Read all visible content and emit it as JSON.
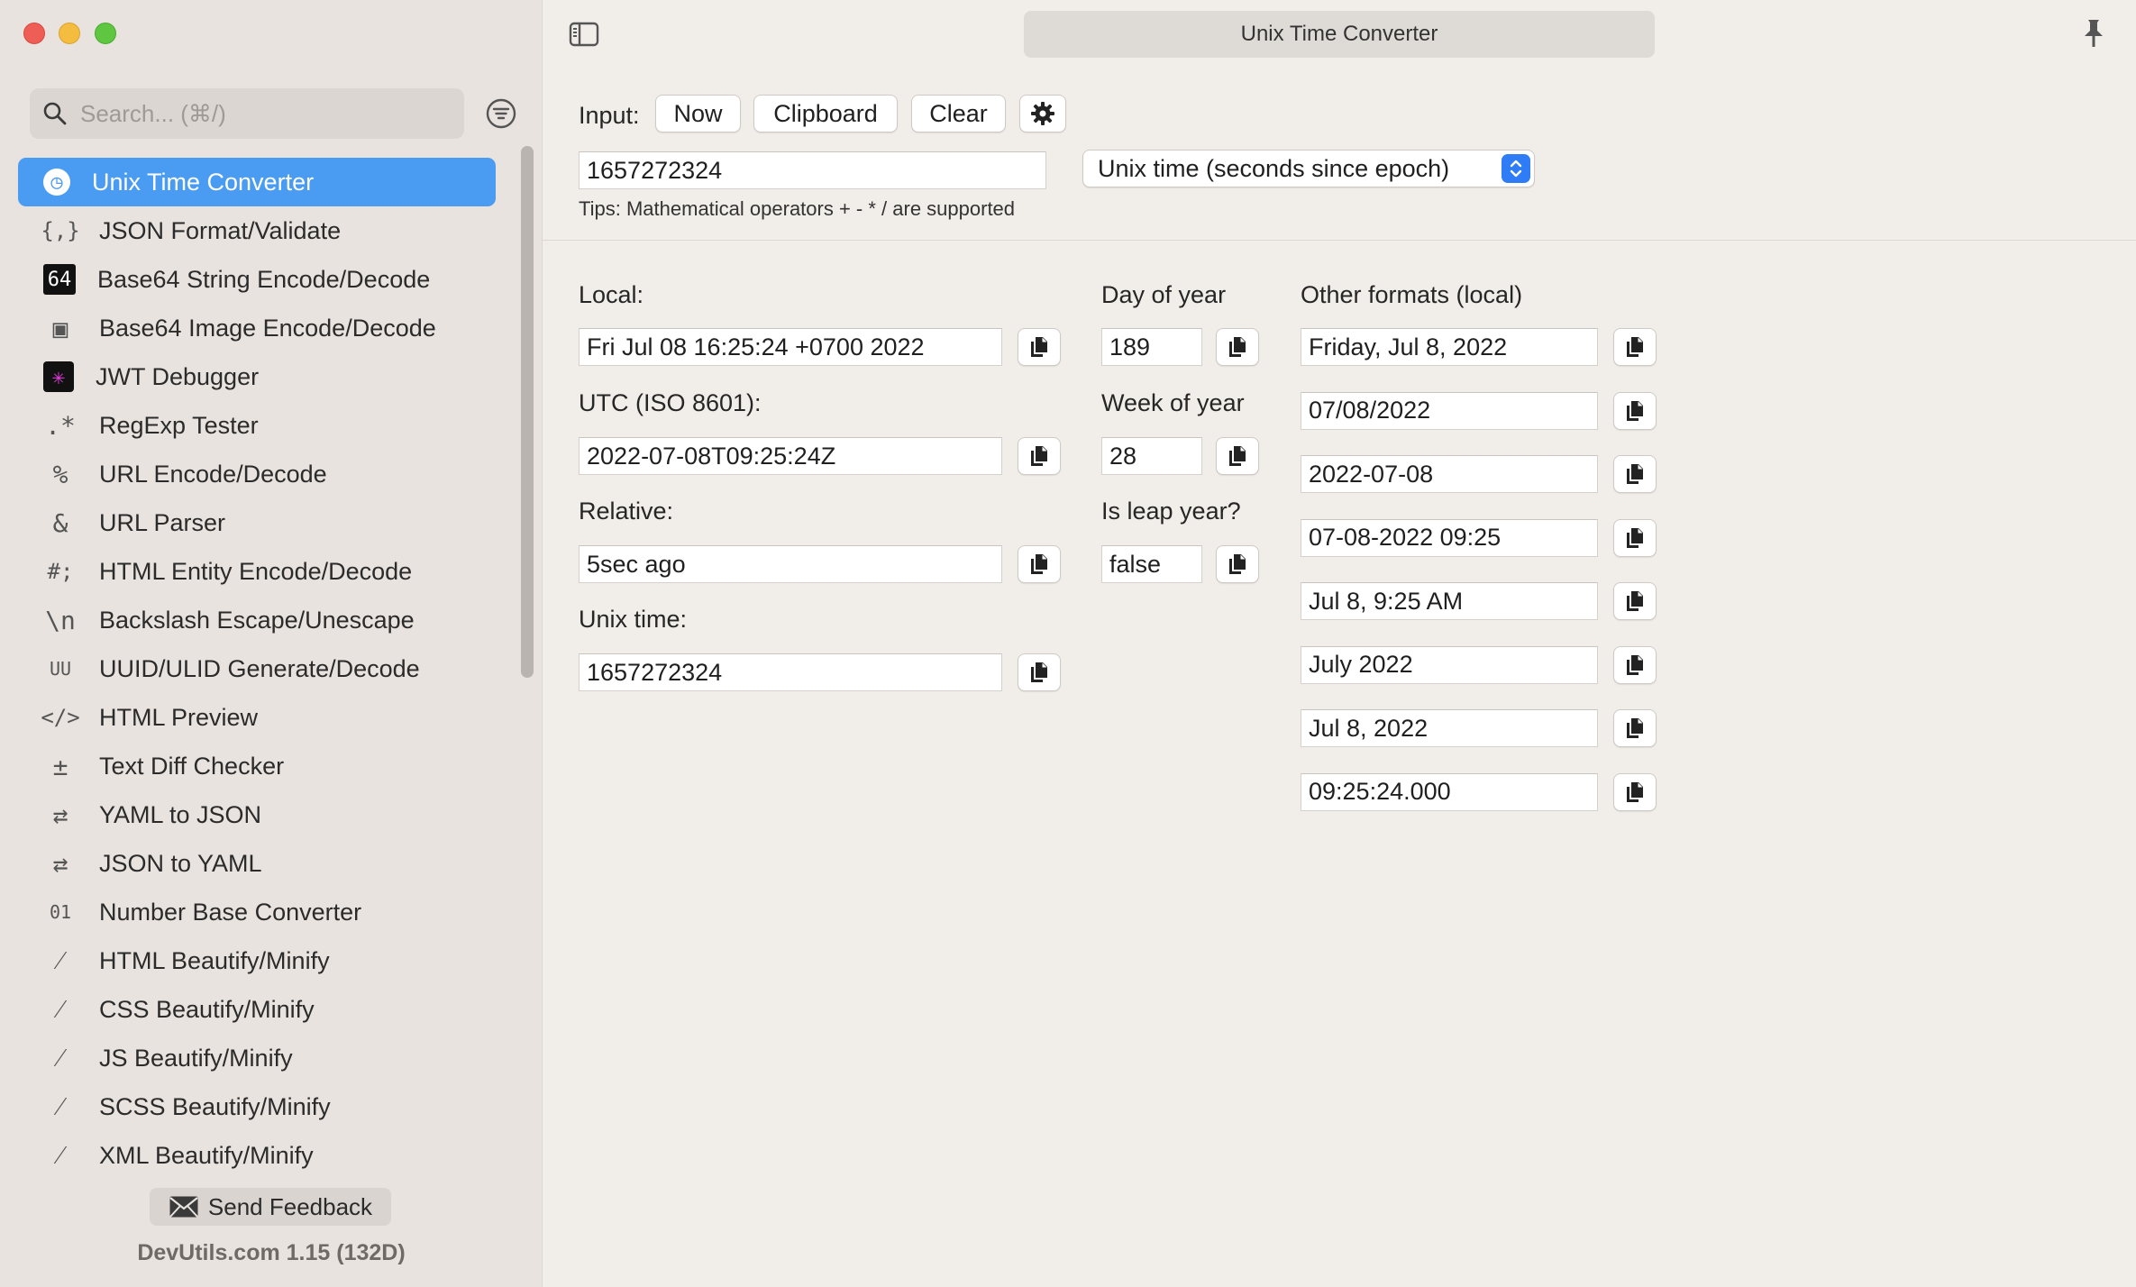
{
  "window": {
    "title": "Unix Time Converter"
  },
  "sidebar": {
    "search_placeholder": "Search... (⌘/)",
    "items": [
      {
        "label": "Unix Time Converter",
        "icon": "clock-icon",
        "glyph": "◷"
      },
      {
        "label": "JSON Format/Validate",
        "icon": "braces-icon",
        "glyph": "{,}"
      },
      {
        "label": "Base64 String Encode/Decode",
        "icon": "base64-icon",
        "glyph": "64"
      },
      {
        "label": "Base64 Image Encode/Decode",
        "icon": "image-icon",
        "glyph": "▣"
      },
      {
        "label": "JWT Debugger",
        "icon": "jwt-icon",
        "glyph": "✳"
      },
      {
        "label": "RegExp Tester",
        "icon": "regex-icon",
        "glyph": ".*"
      },
      {
        "label": "URL Encode/Decode",
        "icon": "percent-icon",
        "glyph": "%"
      },
      {
        "label": "URL Parser",
        "icon": "ampersand-icon",
        "glyph": "&"
      },
      {
        "label": "HTML Entity Encode/Decode",
        "icon": "hash-icon",
        "glyph": "#;"
      },
      {
        "label": "Backslash Escape/Unescape",
        "icon": "backslash-icon",
        "glyph": "\\n"
      },
      {
        "label": "UUID/ULID Generate/Decode",
        "icon": "uuid-icon",
        "glyph": "UU"
      },
      {
        "label": "HTML Preview",
        "icon": "code-icon",
        "glyph": "</>"
      },
      {
        "label": "Text Diff Checker",
        "icon": "diff-icon",
        "glyph": "±"
      },
      {
        "label": "YAML to JSON",
        "icon": "swap-icon",
        "glyph": "⇄"
      },
      {
        "label": "JSON to YAML",
        "icon": "swap-icon",
        "glyph": "⇄"
      },
      {
        "label": "Number Base Converter",
        "icon": "number-base-icon",
        "glyph": "01"
      },
      {
        "label": "HTML Beautify/Minify",
        "icon": "wand-icon",
        "glyph": "⁄"
      },
      {
        "label": "CSS Beautify/Minify",
        "icon": "wand-icon",
        "glyph": "⁄"
      },
      {
        "label": "JS Beautify/Minify",
        "icon": "wand-icon",
        "glyph": "⁄"
      },
      {
        "label": "SCSS Beautify/Minify",
        "icon": "wand-icon",
        "glyph": "⁄"
      },
      {
        "label": "XML Beautify/Minify",
        "icon": "wand-icon",
        "glyph": "⁄"
      }
    ],
    "feedback_label": "Send Feedback",
    "version": "DevUtils.com 1.15 (132D)"
  },
  "input": {
    "label": "Input:",
    "now_label": "Now",
    "clipboard_label": "Clipboard",
    "clear_label": "Clear",
    "value": "1657272324",
    "format": "Unix time (seconds since epoch)",
    "tips": "Tips: Mathematical operators + - * / are supported"
  },
  "results": {
    "local_label": "Local:",
    "local_value": "Fri Jul 08 16:25:24 +0700 2022",
    "utc_label": "UTC (ISO 8601):",
    "utc_value": "2022-07-08T09:25:24Z",
    "relative_label": "Relative:",
    "relative_value": "5sec ago",
    "unix_label": "Unix time:",
    "unix_value": "1657272324",
    "day_of_year_label": "Day of year",
    "day_of_year_value": "189",
    "week_of_year_label": "Week of year",
    "week_of_year_value": "28",
    "leap_label": "Is leap year?",
    "leap_value": "false",
    "other_label": "Other formats (local)",
    "other_formats": [
      "Friday, Jul 8, 2022",
      "07/08/2022",
      "2022-07-08",
      "07-08-2022 09:25",
      "Jul 8, 9:25 AM",
      "July 2022",
      "Jul 8, 2022",
      "09:25:24.000"
    ]
  },
  "colors": {
    "accent": "#4a9bf2",
    "select_arrows": "#2e7cf6",
    "sidebar_bg": "#e8e3de",
    "main_bg": "#f1ede8"
  }
}
